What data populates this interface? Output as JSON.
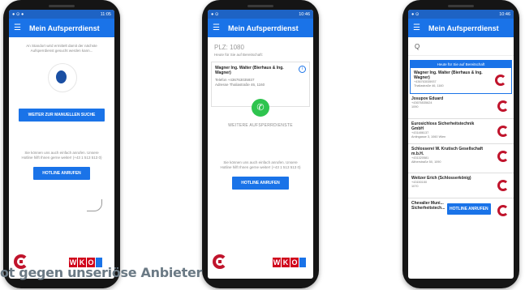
{
  "colors": {
    "primary": "#1a73e8",
    "brand_red": "#c0142c"
  },
  "status_times": [
    "11:05",
    "10:46",
    "10:46"
  ],
  "app_title": "Mein Aufsperrdienst",
  "phone1": {
    "search_text": "An Standort wird ermittelt damit der nächste Aufsperrdienst gesucht werden kann...",
    "manual_search_button": "WEITER ZUR MANUELLEN SUCHE",
    "hotline_text": "Sie können uns auch einfach anrufen. Unsere Hotline hilft Ihnen gerne weiter! (+43 1 513 513 0)",
    "hotline_button": "HOTLINE ANRUFEN",
    "logo_text": "WKO"
  },
  "phone2": {
    "plz": "PLZ: 1080",
    "subtitle": "Heute für Sie auf Bereitschaft:",
    "company": "Wagner Ing. Walter (Bierhaus & Ing. Wagner)",
    "telefon_label": "Telefon",
    "telefon": "+436763035937",
    "adresse_label": "Adresse",
    "adresse": "Thaliastraße 46, 1160",
    "more_button": "WEITERE AUFSPERRDIENSTE",
    "hotline_text": "Sie können uns auch einfach anrufen. Unsere Hotline hilft Ihnen gerne weiter! (+43 1 513 513 0)",
    "hotline_button": "HOTLINE ANRUFEN",
    "logo_text": "WKO"
  },
  "phone3": {
    "search_placeholder": "Q",
    "banner": "Heute für Sie auf Bereitschaft",
    "items": [
      {
        "name": "Wagner Ing. Walter (Bierhaus & Ing. Wagner)",
        "telefon": "+436763035937",
        "adresse": "Thaliastraße 46, 1160"
      },
      {
        "name": "Josupov Eduard",
        "telefon": "+43676535624",
        "adresse": "1090"
      },
      {
        "name": "Eurosichloss Sicherheitstechnik GmbH",
        "telefon": "+431486137",
        "adresse": "Antingasse 3, 1060 Wien"
      },
      {
        "name": "Schlosserei W. Krutisch Gesellschaft m.b.H.",
        "telefon": "+431320581",
        "adresse": "Altherstraße 50, 1090"
      },
      {
        "name": "Weitzer Erich (Schlosserkönig)",
        "telefon": "+43150150",
        "adresse": "1070"
      },
      {
        "name": "Chevalier Muni... Sicherheitstech...",
        "telefon": "",
        "adresse": ""
      }
    ],
    "hotline_button": "HOTLINE ANRUFEN"
  },
  "caption": "ot gegen unseriöse Anbieter"
}
